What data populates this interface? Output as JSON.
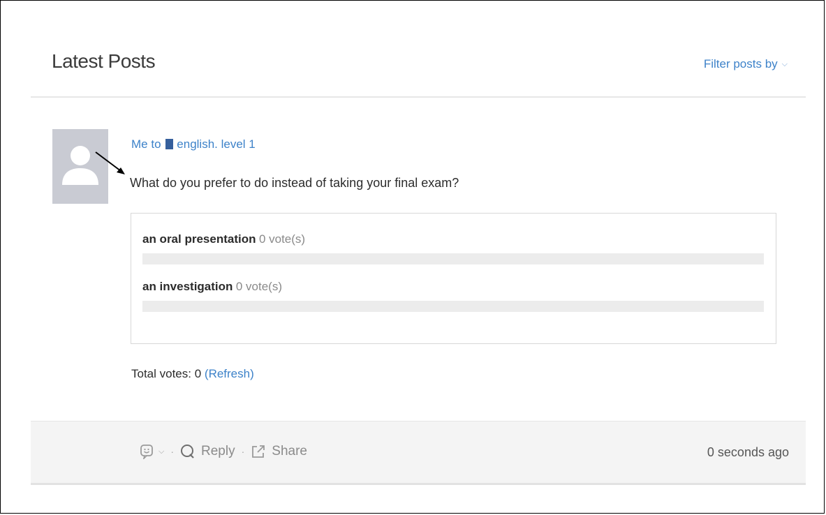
{
  "header": {
    "title": "Latest Posts",
    "filter_label": "Filter posts by",
    "filter_chevron": "⌵"
  },
  "post": {
    "author": "Me",
    "to_word": "to",
    "group": "english. level 1",
    "question": "What do you prefer to do instead of taking your final exam?",
    "poll": {
      "options": [
        {
          "label": "an oral presentation",
          "votes_text": "0 vote(s)",
          "votes": 0,
          "fraction": 0
        },
        {
          "label": "an investigation",
          "votes_text": "0 vote(s)",
          "votes": 0,
          "fraction": 0
        }
      ]
    },
    "total_label": "Total votes: 0",
    "refresh_label": "(Refresh)"
  },
  "footer": {
    "reaction_chevron": "⌵",
    "separator": "·",
    "reply_label": "Reply",
    "share_label": "Share",
    "timestamp": "0 seconds ago"
  },
  "icons": {
    "avatar": "user-silhouette",
    "reaction": "smiley-icon",
    "reply": "speech-bubble-icon",
    "share": "external-link-icon",
    "annotation": "arrow-icon"
  },
  "colors": {
    "link": "#3d82c9",
    "group_square": "#355f9c",
    "avatar_bg": "#c9cbd3",
    "bar_track": "#ececec",
    "footer_bg": "#f4f4f4"
  }
}
